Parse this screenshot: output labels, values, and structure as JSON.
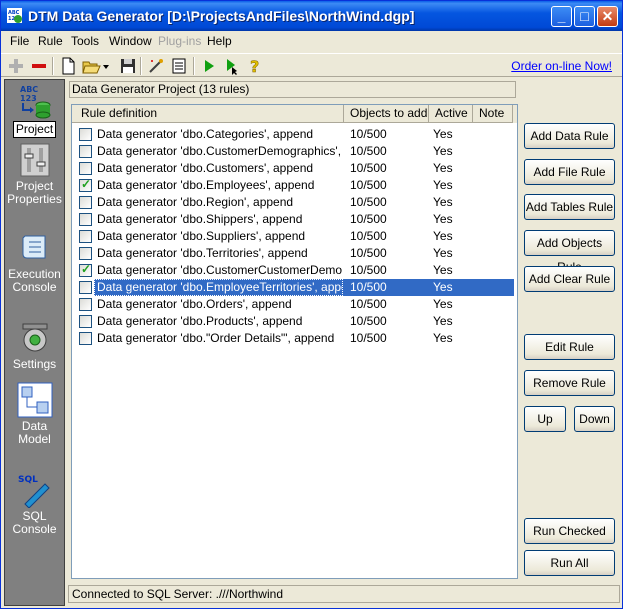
{
  "window": {
    "title": "DTM Data Generator [D:\\ProjectsAndFiles\\NorthWind.dgp]",
    "controls": {
      "minimize": "_",
      "maximize": "□",
      "close": "✕"
    }
  },
  "menu": [
    {
      "label": "File",
      "disabled": false
    },
    {
      "label": "Rule",
      "disabled": false
    },
    {
      "label": "Tools",
      "disabled": false
    },
    {
      "label": "Window",
      "disabled": false
    },
    {
      "label": "Plug-ins",
      "disabled": true
    },
    {
      "label": "Help",
      "disabled": false
    }
  ],
  "toolbar": {
    "order_link": "Order on-line Now!",
    "icons": [
      "add-icon",
      "remove-icon",
      "new-icon",
      "open-icon",
      "save-icon",
      "wand-icon",
      "list-icon",
      "run-icon",
      "run-step-icon",
      "help-icon"
    ]
  },
  "sidebar": [
    {
      "label": "Project",
      "icon": "project-icon",
      "active": true
    },
    {
      "label": "Project Properties",
      "icon": "properties-icon",
      "active": false
    },
    {
      "label": "Execution Console",
      "icon": "scroll-icon",
      "active": false
    },
    {
      "label": "Settings",
      "icon": "gear-icon",
      "active": false
    },
    {
      "label": "Data Model",
      "icon": "data-model-icon",
      "active": false
    },
    {
      "label": "SQL Console",
      "icon": "sql-pen-icon",
      "active": false
    }
  ],
  "panel": {
    "title": "Data Generator Project (13 rules)"
  },
  "list": {
    "columns": [
      "Rule definition",
      "Objects to add",
      "Active",
      "Note"
    ],
    "rows": [
      {
        "checked": false,
        "definition": "Data generator 'dbo.Categories', append",
        "objects": "10/500",
        "active": "Yes",
        "note": "",
        "selected": false
      },
      {
        "checked": false,
        "definition": "Data generator 'dbo.CustomerDemographics', app...",
        "objects": "10/500",
        "active": "Yes",
        "note": "",
        "selected": false
      },
      {
        "checked": false,
        "definition": "Data generator 'dbo.Customers', append",
        "objects": "10/500",
        "active": "Yes",
        "note": "",
        "selected": false
      },
      {
        "checked": true,
        "definition": "Data generator 'dbo.Employees', append",
        "objects": "10/500",
        "active": "Yes",
        "note": "",
        "selected": false
      },
      {
        "checked": false,
        "definition": "Data generator 'dbo.Region', append",
        "objects": "10/500",
        "active": "Yes",
        "note": "",
        "selected": false
      },
      {
        "checked": false,
        "definition": "Data generator 'dbo.Shippers', append",
        "objects": "10/500",
        "active": "Yes",
        "note": "",
        "selected": false
      },
      {
        "checked": false,
        "definition": "Data generator 'dbo.Suppliers', append",
        "objects": "10/500",
        "active": "Yes",
        "note": "",
        "selected": false
      },
      {
        "checked": false,
        "definition": "Data generator 'dbo.Territories', append",
        "objects": "10/500",
        "active": "Yes",
        "note": "",
        "selected": false
      },
      {
        "checked": true,
        "definition": "Data generator 'dbo.CustomerCustomerDemo', ap...",
        "objects": "10/500",
        "active": "Yes",
        "note": "",
        "selected": false
      },
      {
        "checked": false,
        "definition": "Data generator 'dbo.EmployeeTerritories', append",
        "objects": "10/500",
        "active": "Yes",
        "note": "",
        "selected": true
      },
      {
        "checked": false,
        "definition": "Data generator 'dbo.Orders', append",
        "objects": "10/500",
        "active": "Yes",
        "note": "",
        "selected": false
      },
      {
        "checked": false,
        "definition": "Data generator 'dbo.Products', append",
        "objects": "10/500",
        "active": "Yes",
        "note": "",
        "selected": false
      },
      {
        "checked": false,
        "definition": "Data generator 'dbo.\"Order Details\"', append",
        "objects": "10/500",
        "active": "Yes",
        "note": "",
        "selected": false
      }
    ]
  },
  "buttons": {
    "add_data_rule": "Add Data Rule",
    "add_file_rule": "Add File Rule",
    "add_tables_rule": "Add Tables Rule",
    "add_objects_rule": "Add Objects Rule",
    "add_clear_rule": "Add Clear Rule",
    "edit_rule": "Edit Rule",
    "remove_rule": "Remove Rule",
    "up": "Up",
    "down": "Down",
    "run_checked": "Run Checked",
    "run_all": "Run All"
  },
  "status": "Connected to SQL Server: .///Northwind",
  "colors": {
    "titlebar": "#0055e5",
    "selection": "#316ac5",
    "sidebar": "#808080",
    "link": "#0000ff"
  }
}
